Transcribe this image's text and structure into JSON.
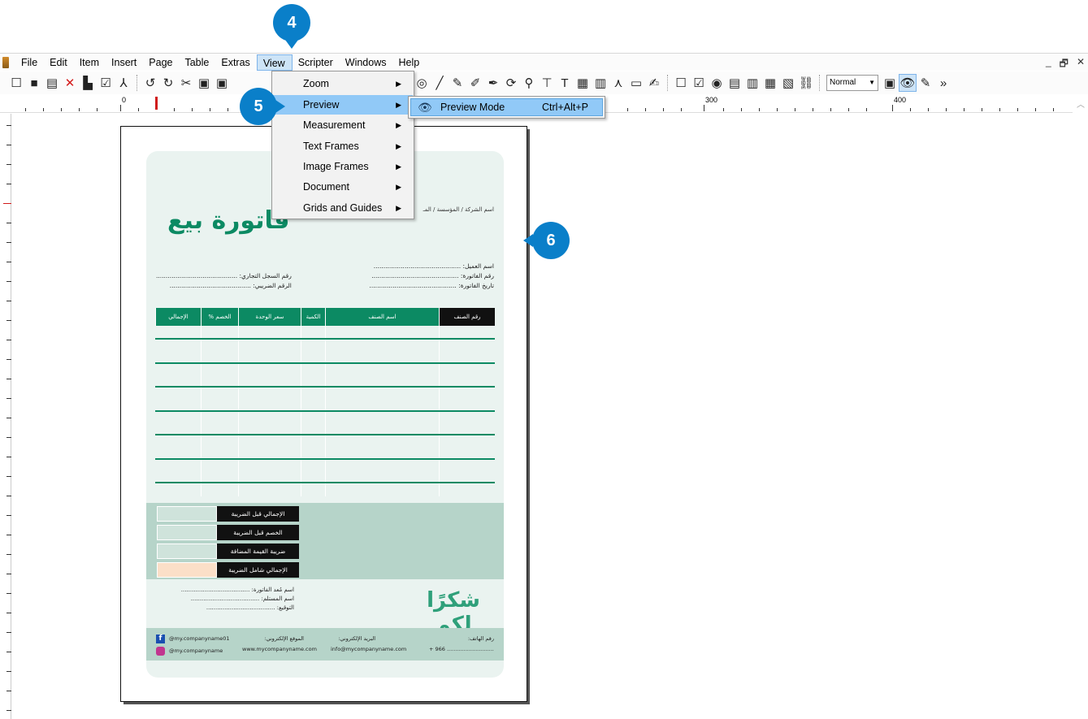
{
  "badges": {
    "step4": "4",
    "step5": "5",
    "step6": "6"
  },
  "menubar": {
    "items": [
      "File",
      "Edit",
      "Item",
      "Insert",
      "Page",
      "Table",
      "Extras",
      "View",
      "Scripter",
      "Windows",
      "Help"
    ],
    "active": "View"
  },
  "toolbar": {
    "mode_select": "Normal"
  },
  "ruler": {
    "labels": [
      "0",
      "300",
      "400"
    ]
  },
  "view_menu": {
    "items": [
      "Zoom",
      "Preview",
      "Measurement",
      "Text Frames",
      "Image Frames",
      "Document",
      "Grids and Guides"
    ],
    "highlighted": "Preview"
  },
  "preview_submenu": {
    "label": "Preview Mode",
    "shortcut": "Ctrl+Alt+P"
  },
  "invoice": {
    "title": "فاتورة بيع",
    "company_line": "اسم الشركة / المؤسسة / المـ",
    "fields_right": [
      "اسم العميل: .............................................",
      "رقم الفاتورة: .............................................",
      "تاريخ الفاتورة: ............................................."
    ],
    "fields_left": [
      "رقم السجل التجاري: ..........................................",
      "الرقم الضريبي: .........................................."
    ],
    "columns": [
      "رقم الصنف",
      "اسم الصنف",
      "الكمية",
      "سعر الوحدة",
      "الخصم %",
      "الإجمالي"
    ],
    "totals": [
      "الإجمالي قبل الضريبة",
      "الخصم قبل الضريبة",
      "ضريبة القيمة المضافة",
      "الإجمالي شامل الضريبة"
    ],
    "thanks": "شكرًا لكم",
    "signature_fields": [
      "اسم مُعد الفاتورة: ......................................",
      "اسم المستلم: ......................................",
      "التوقيع: ......................................"
    ],
    "footer": {
      "phone_label": "رقم الهاتف:",
      "phone_value": "+ 966 ............................",
      "email_label": "البريد الإلكتروني:",
      "email_value": "info@mycompanyname.com",
      "website_label": "الموقع الإلكتروني:",
      "website_value": "www.mycompanyname.com",
      "facebook": "@my.companyname01",
      "instagram": "@my.companyname"
    }
  }
}
